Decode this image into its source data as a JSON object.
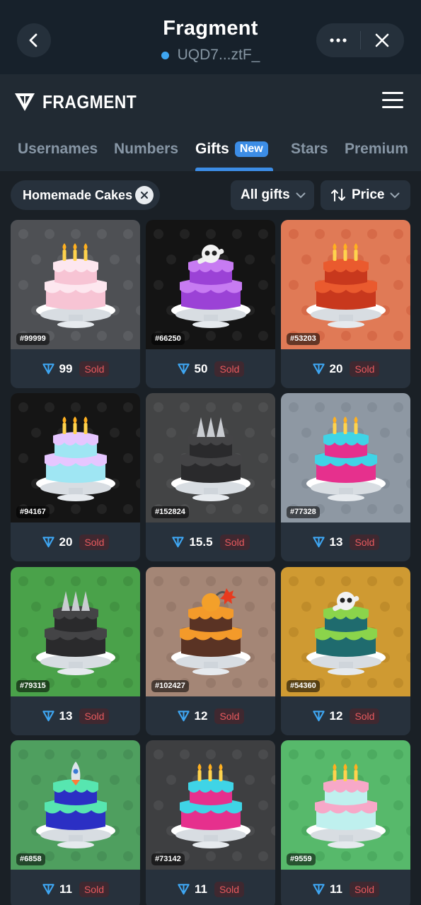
{
  "app": {
    "title": "Fragment",
    "subtitle": "UQD7...ztF_",
    "back_icon": "chevron-left-icon",
    "more_icon": "more-horizontal-icon",
    "close_icon": "close-icon"
  },
  "header": {
    "logo_text": "FRAGMENT",
    "menu_icon": "hamburger-menu-icon"
  },
  "tabs": [
    {
      "label": "Usernames",
      "active": false
    },
    {
      "label": "Numbers",
      "active": false
    },
    {
      "label": "Gifts",
      "active": true,
      "badge": "New"
    },
    {
      "label": "Stars",
      "active": false
    },
    {
      "label": "Premium",
      "active": false
    }
  ],
  "filters": {
    "collection": "Homemade Cakes",
    "gift_filter": "All gifts",
    "sort": "Price"
  },
  "colors": {
    "accent": "#3c8de6",
    "sold_text": "#e85a5e",
    "ton": "#3ea6f2"
  },
  "gifts": [
    {
      "number": "#99999",
      "price": "99",
      "status": "Sold",
      "bg": "#4e5054",
      "pattern": "#5b5d61",
      "cake": "#f7c4d4",
      "frost": "#fde7ef",
      "top": "candles"
    },
    {
      "number": "#66250",
      "price": "50",
      "status": "Sold",
      "bg": "#141414",
      "pattern": "#222222",
      "cake": "#9b42d6",
      "frost": "#c77bf2",
      "top": "skull"
    },
    {
      "number": "#53203",
      "price": "20",
      "status": "Sold",
      "bg": "#e07a56",
      "pattern": "#d66a48",
      "cake": "#c8381d",
      "frost": "#ea5a2e",
      "top": "candles"
    },
    {
      "number": "#94167",
      "price": "20",
      "status": "Sold",
      "bg": "#151515",
      "pattern": "#232323",
      "cake": "#9fe6f3",
      "frost": "#e6c6ff",
      "top": "candles"
    },
    {
      "number": "#152824",
      "price": "15.5",
      "status": "Sold",
      "bg": "#434445",
      "pattern": "#4e4f50",
      "cake": "#2a2a2c",
      "frost": "#444446",
      "top": "spikes"
    },
    {
      "number": "#77328",
      "price": "13",
      "status": "Sold",
      "bg": "#8e98a3",
      "pattern": "#838d98",
      "cake": "#e6308d",
      "frost": "#3fd4e6",
      "top": "candles"
    },
    {
      "number": "#79315",
      "price": "13",
      "status": "Sold",
      "bg": "#4aa24a",
      "pattern": "#429342",
      "cake": "#2a2a2c",
      "frost": "#444446",
      "top": "spikes"
    },
    {
      "number": "#102427",
      "price": "12",
      "status": "Sold",
      "bg": "#a48676",
      "pattern": "#977a6b",
      "cake": "#5a3324",
      "frost": "#f39a2a",
      "top": "bomb"
    },
    {
      "number": "#54360",
      "price": "12",
      "status": "Sold",
      "bg": "#cf9a32",
      "pattern": "#bf8c2a",
      "cake": "#1f6b6e",
      "frost": "#8bd44b",
      "top": "skull"
    },
    {
      "number": "#6858",
      "price": "11",
      "status": "Sold",
      "bg": "#4f9f5f",
      "pattern": "#479157",
      "cake": "#2b2fc4",
      "frost": "#57e6b0",
      "top": "rocket"
    },
    {
      "number": "#73142",
      "price": "11",
      "status": "Sold",
      "bg": "#3e3f41",
      "pattern": "#4a4b4d",
      "cake": "#e6308d",
      "frost": "#3fd4e6",
      "top": "candles"
    },
    {
      "number": "#9559",
      "price": "11",
      "status": "Sold",
      "bg": "#57b96b",
      "pattern": "#4cab60",
      "cake": "#bff0ee",
      "frost": "#f7a8c8",
      "top": "candles"
    }
  ]
}
